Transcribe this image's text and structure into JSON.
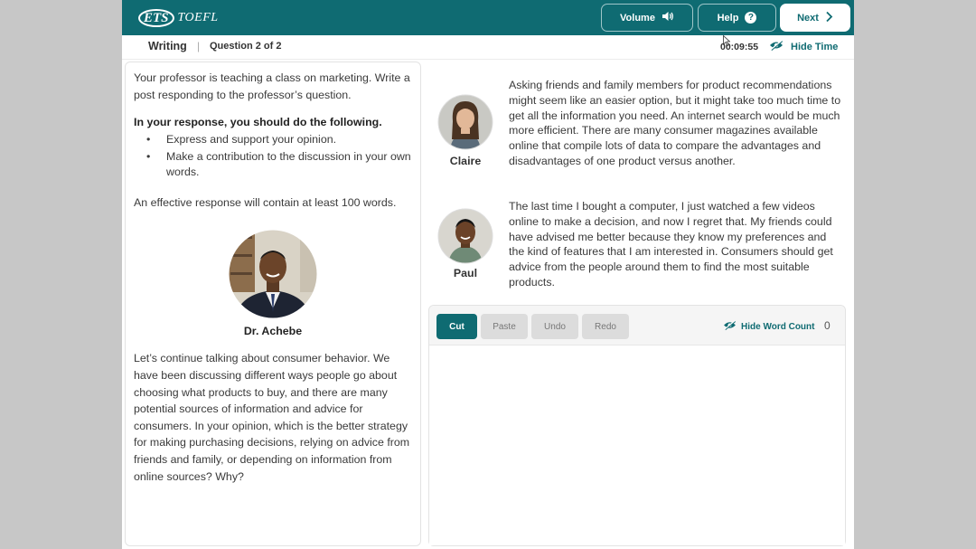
{
  "header": {
    "logo_ets": "ETS",
    "logo_toefl": "TOEFL",
    "volume_label": "Volume",
    "help_label": "Help",
    "next_label": "Next"
  },
  "subheader": {
    "section": "Writing",
    "separator": "|",
    "question": "Question 2 of 2",
    "timer": "00:09:55",
    "hide_time_label": "Hide Time"
  },
  "left": {
    "prompt": "Your professor is teaching a class on marketing. Write a post responding to the professor’s question.",
    "instructions_heading": "In your response, you should do the following.",
    "instructions": [
      "Express and support your opinion.",
      "Make a contribution to the discussion in your own words."
    ],
    "word_requirement": "An effective response will contain at least 100 words.",
    "professor_name": "Dr. Achebe",
    "professor_text": "Let’s continue talking about consumer behavior. We have been discussing different ways people go about choosing what products to buy, and there are many potential sources of information and advice for consumers. In your opinion, which is the better strategy for making purchasing decisions, relying on advice from friends and family, or depending on information from online sources? Why?"
  },
  "posts": [
    {
      "name": "Claire",
      "text": "Asking friends and family members for product recommendations might seem like an easier option, but it might take too much time to get all the information you need. An internet search would be much more efficient. There are many consumer magazines available online that compile lots of data to compare the advantages and disadvantages of one product versus another."
    },
    {
      "name": "Paul",
      "text": "The last time I bought a computer, I just watched a few videos online to make a decision, and now I regret that. My friends could have advised me better because they know my preferences and the kind of features that I am interested in. Consumers should get advice from the people around them to find the most suitable products."
    }
  ],
  "editor": {
    "cut_label": "Cut",
    "paste_label": "Paste",
    "undo_label": "Undo",
    "redo_label": "Redo",
    "hide_word_count_label": "Hide Word Count",
    "word_count": "0",
    "response_value": ""
  },
  "colors": {
    "accent": "#0f6b72",
    "background": "#c7c7c7",
    "disabled_button": "#dcdcdc"
  },
  "icons": {
    "volume": "speaker-icon",
    "help": "question-circle-icon",
    "next": "chevron-right-icon",
    "hide_time": "eye-slash-icon",
    "hide_word_count": "eye-slash-icon"
  }
}
